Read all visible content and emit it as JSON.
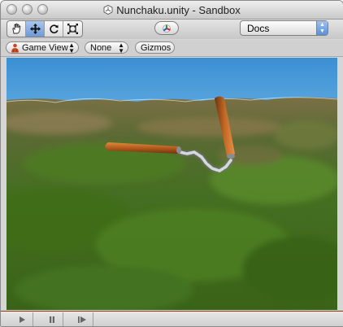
{
  "window": {
    "title": "Nunchaku.unity - Sandbox",
    "traffic_lights": [
      "close",
      "minimize",
      "zoom"
    ]
  },
  "toolbar": {
    "tools": [
      {
        "name": "hand-tool-icon",
        "active": false
      },
      {
        "name": "move-tool-icon",
        "active": true
      },
      {
        "name": "rotate-tool-icon",
        "active": false
      },
      {
        "name": "scale-tool-icon",
        "active": false
      }
    ],
    "gizmo_icon": "axis-gizmo-icon",
    "docs_label": "Docs"
  },
  "options": {
    "view_label": "Game View",
    "render_mode": "None",
    "gizmos_label": "Gizmos"
  },
  "playback": {
    "controls": [
      "play-icon",
      "pause-icon",
      "step-icon"
    ]
  },
  "colors": {
    "sky": "#3f8fd0",
    "grass": "#3e6e1e",
    "wood": "#b35b1e",
    "chain": "#c9ccd1",
    "selection_blue": "#6c9ad9"
  }
}
